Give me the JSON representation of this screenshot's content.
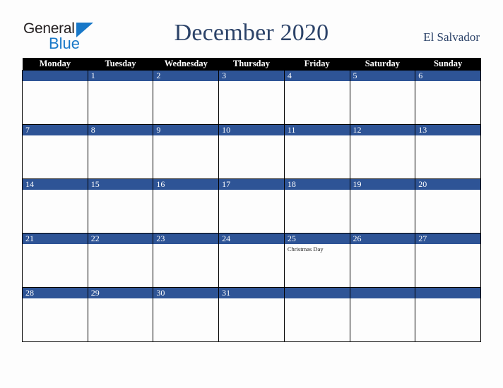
{
  "brand": {
    "name_part1": "General",
    "name_part2": "Blue",
    "triangle_color": "#1878c8",
    "text_color": "#231f20"
  },
  "header": {
    "title": "December 2020",
    "subtitle": "El Salvador",
    "title_color": "#2b4268"
  },
  "calendar": {
    "month": "December",
    "year": "2020",
    "week_start": "Monday",
    "colors": {
      "header_bg": "#000000",
      "header_text": "#ffffff",
      "day_band": "#2e5496",
      "day_number": "#ffffff",
      "cell_bg": "#fdfdfd",
      "border": "#000000",
      "event_text": "#1a1a1a"
    },
    "weekdays": [
      "Monday",
      "Tuesday",
      "Wednesday",
      "Thursday",
      "Friday",
      "Saturday",
      "Sunday"
    ],
    "weeks": [
      [
        {
          "day": "",
          "events": []
        },
        {
          "day": "1",
          "events": []
        },
        {
          "day": "2",
          "events": []
        },
        {
          "day": "3",
          "events": []
        },
        {
          "day": "4",
          "events": []
        },
        {
          "day": "5",
          "events": []
        },
        {
          "day": "6",
          "events": []
        }
      ],
      [
        {
          "day": "7",
          "events": []
        },
        {
          "day": "8",
          "events": []
        },
        {
          "day": "9",
          "events": []
        },
        {
          "day": "10",
          "events": []
        },
        {
          "day": "11",
          "events": []
        },
        {
          "day": "12",
          "events": []
        },
        {
          "day": "13",
          "events": []
        }
      ],
      [
        {
          "day": "14",
          "events": []
        },
        {
          "day": "15",
          "events": []
        },
        {
          "day": "16",
          "events": []
        },
        {
          "day": "17",
          "events": []
        },
        {
          "day": "18",
          "events": []
        },
        {
          "day": "19",
          "events": []
        },
        {
          "day": "20",
          "events": []
        }
      ],
      [
        {
          "day": "21",
          "events": []
        },
        {
          "day": "22",
          "events": []
        },
        {
          "day": "23",
          "events": []
        },
        {
          "day": "24",
          "events": []
        },
        {
          "day": "25",
          "events": [
            "Christmas Day"
          ]
        },
        {
          "day": "26",
          "events": []
        },
        {
          "day": "27",
          "events": []
        }
      ],
      [
        {
          "day": "28",
          "events": []
        },
        {
          "day": "29",
          "events": []
        },
        {
          "day": "30",
          "events": []
        },
        {
          "day": "31",
          "events": []
        },
        {
          "day": "",
          "events": []
        },
        {
          "day": "",
          "events": []
        },
        {
          "day": "",
          "events": []
        }
      ]
    ]
  }
}
